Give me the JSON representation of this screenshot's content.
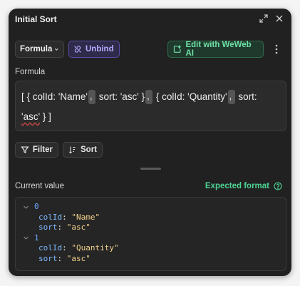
{
  "panel": {
    "title": "Initial Sort"
  },
  "toolbar": {
    "mode_label": "Formula",
    "unbind_label": "Unbind",
    "ai_label": "Edit with WeWeb AI"
  },
  "formula": {
    "label": "Formula",
    "seg1": "[ { colId: 'Name'",
    "seg2": " sort: 'asc' }",
    "seg3": " { colId: 'Quantity'",
    "seg4": " sort:",
    "seg5a": "'asc'",
    "seg5b": " } ]"
  },
  "actions": {
    "filter_label": "Filter",
    "sort_label": "Sort"
  },
  "current": {
    "label": "Current value",
    "expected_label": "Expected format",
    "tree": [
      {
        "index": "0",
        "colId_key": "colId",
        "colId_val": "\"Name\"",
        "sort_key": "sort",
        "sort_val": "\"asc\""
      },
      {
        "index": "1",
        "colId_key": "colId",
        "colId_val": "\"Quantity\"",
        "sort_key": "sort",
        "sort_val": "\"asc\""
      }
    ]
  },
  "colors": {
    "panel_bg": "#212121",
    "accent_purple": "#b8a9ff",
    "accent_green": "#6fe0a8",
    "string_color": "#f2d08a",
    "key_color": "#7cb8ff"
  }
}
